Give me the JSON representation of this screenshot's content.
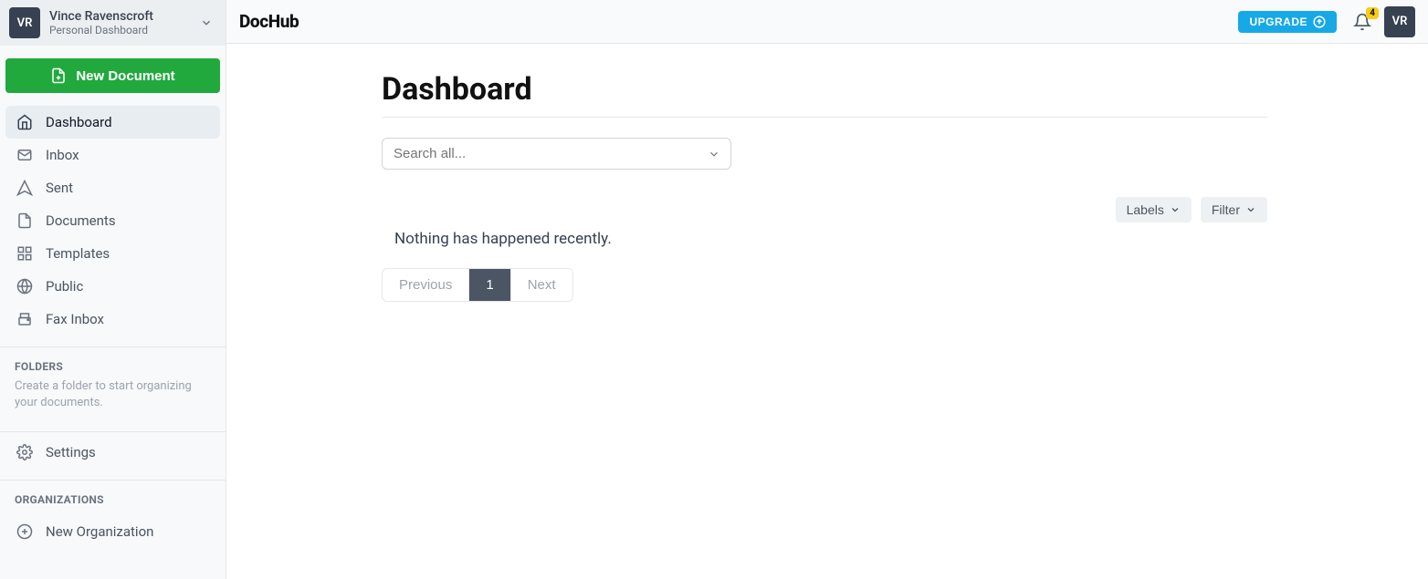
{
  "user": {
    "initials": "VR",
    "name": "Vince Ravenscroft",
    "subtitle": "Personal Dashboard"
  },
  "sidebar": {
    "new_document": "New Document",
    "nav": [
      {
        "label": "Dashboard"
      },
      {
        "label": "Inbox"
      },
      {
        "label": "Sent"
      },
      {
        "label": "Documents"
      },
      {
        "label": "Templates"
      },
      {
        "label": "Public"
      },
      {
        "label": "Fax Inbox"
      }
    ],
    "folders": {
      "title": "FOLDERS",
      "help": "Create a folder to start organizing your documents."
    },
    "settings_label": "Settings",
    "organizations": {
      "title": "ORGANIZATIONS",
      "new_label": "New Organization"
    }
  },
  "topbar": {
    "brand": "DocHub",
    "upgrade": "UPGRADE",
    "notification_count": "4",
    "avatar_initials": "VR"
  },
  "main": {
    "title": "Dashboard",
    "search_placeholder": "Search all...",
    "labels_btn": "Labels",
    "filter_btn": "Filter",
    "empty_message": "Nothing has happened recently.",
    "pager": {
      "prev": "Previous",
      "page": "1",
      "next": "Next"
    }
  }
}
